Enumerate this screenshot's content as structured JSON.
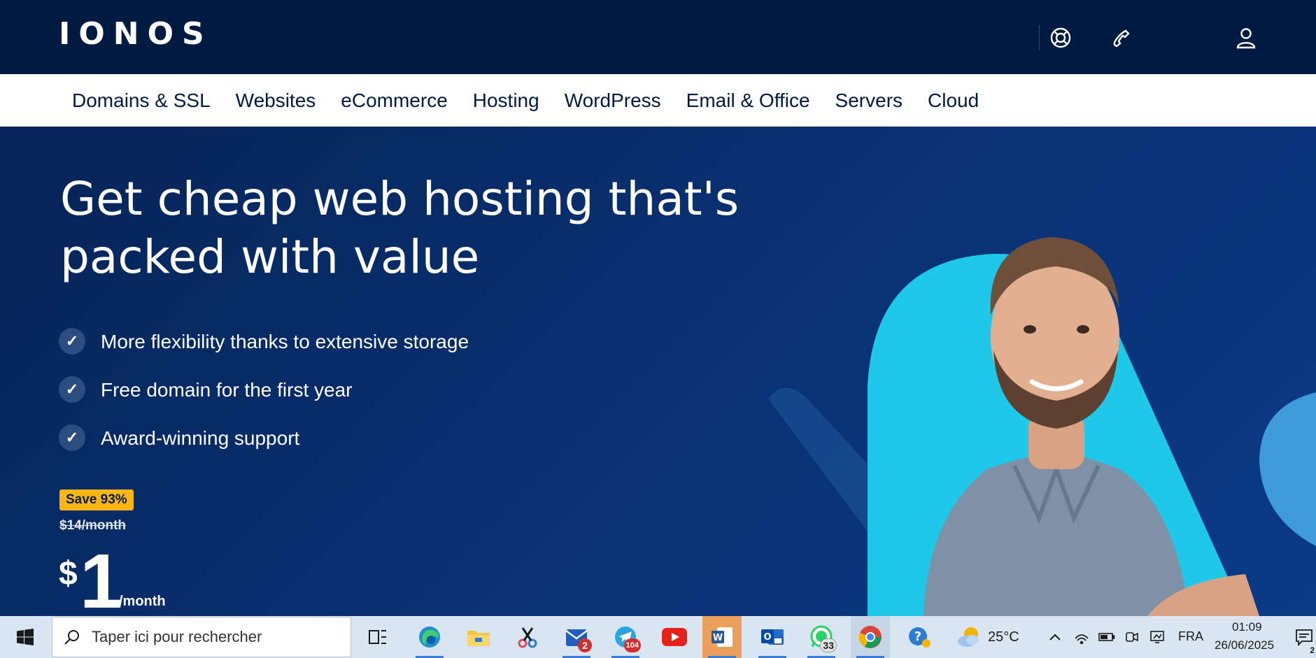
{
  "brand": {
    "logo": "IONOS"
  },
  "header_icons": [
    "help-lifebuoy-icon",
    "phone-icon",
    "user-account-icon"
  ],
  "nav": {
    "items": [
      "Domains & SSL",
      "Websites",
      "eCommerce",
      "Hosting",
      "WordPress",
      "Email & Office",
      "Servers",
      "Cloud"
    ]
  },
  "hero": {
    "title_line1": "Get cheap web hosting that's",
    "title_line2": "packed with value",
    "features": [
      "More flexibility thanks to extensive storage",
      "Free domain for the first year",
      "Award-winning support"
    ],
    "badge": "Save 93%",
    "old_price": "$14/month",
    "price_currency": "$",
    "price_amount": "1",
    "price_period": "/month"
  },
  "taskbar": {
    "search_placeholder": "Taper ici pour rechercher",
    "apps": [
      {
        "name": "task-view-icon"
      },
      {
        "name": "edge-icon"
      },
      {
        "name": "file-explorer-icon"
      },
      {
        "name": "snipping-tool-icon"
      },
      {
        "name": "mail-app-icon",
        "badge": "2"
      },
      {
        "name": "telegram-icon",
        "badge": "104"
      },
      {
        "name": "youtube-icon"
      },
      {
        "name": "word-icon"
      },
      {
        "name": "outlook-icon"
      },
      {
        "name": "whatsapp-icon",
        "badge": "33"
      },
      {
        "name": "chrome-icon"
      },
      {
        "name": "help-app-icon"
      }
    ],
    "weather_temp": "25°C",
    "language": "FRA",
    "time": "01:09",
    "date": "26/06/2025",
    "notification_count": "2"
  },
  "colors": {
    "header_bg": "#001b41",
    "hero_bg": "#0a3275",
    "accent_badge": "#fbb615",
    "art_cyan": "#1ec8e8",
    "taskbar_bg": "#d9e6f2"
  }
}
